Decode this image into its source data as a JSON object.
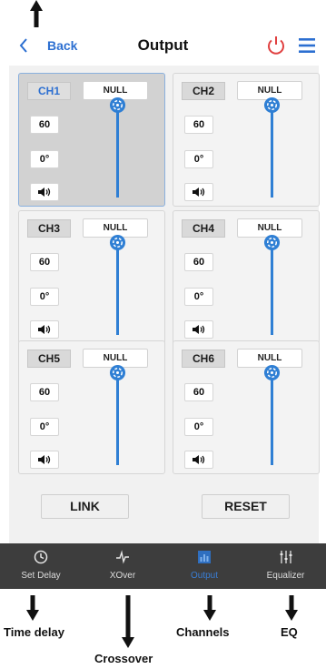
{
  "header": {
    "back_label": "Back",
    "title": "Output"
  },
  "channels": [
    {
      "label": "CH1",
      "null_label": "NULL",
      "freq": "60",
      "phase": "0°",
      "selected": true
    },
    {
      "label": "CH2",
      "null_label": "NULL",
      "freq": "60",
      "phase": "0°",
      "selected": false
    },
    {
      "label": "CH3",
      "null_label": "NULL",
      "freq": "60",
      "phase": "0°",
      "selected": false
    },
    {
      "label": "CH4",
      "null_label": "NULL",
      "freq": "60",
      "phase": "0°",
      "selected": false
    },
    {
      "label": "CH5",
      "null_label": "NULL",
      "freq": "60",
      "phase": "0°",
      "selected": false
    },
    {
      "label": "CH6",
      "null_label": "NULL",
      "freq": "60",
      "phase": "0°",
      "selected": false
    }
  ],
  "actions": {
    "link_label": "LINK",
    "reset_label": "RESET"
  },
  "nav": [
    {
      "label": "Set Delay",
      "icon": "clock-icon",
      "active": false
    },
    {
      "label": "XOver",
      "icon": "waveform-icon",
      "active": false
    },
    {
      "label": "Output",
      "icon": "bar-chart-icon",
      "active": true
    },
    {
      "label": "Equalizer",
      "icon": "equalizer-icon",
      "active": false
    }
  ],
  "annotations": {
    "time_delay": "Time delay",
    "crossover": "Crossover",
    "channels": "Channels",
    "eq": "EQ"
  },
  "colors": {
    "accent": "#2c6fd1",
    "power": "#e04040",
    "nav_bg": "#3d3d3d",
    "slider": "#2f7fd4"
  }
}
